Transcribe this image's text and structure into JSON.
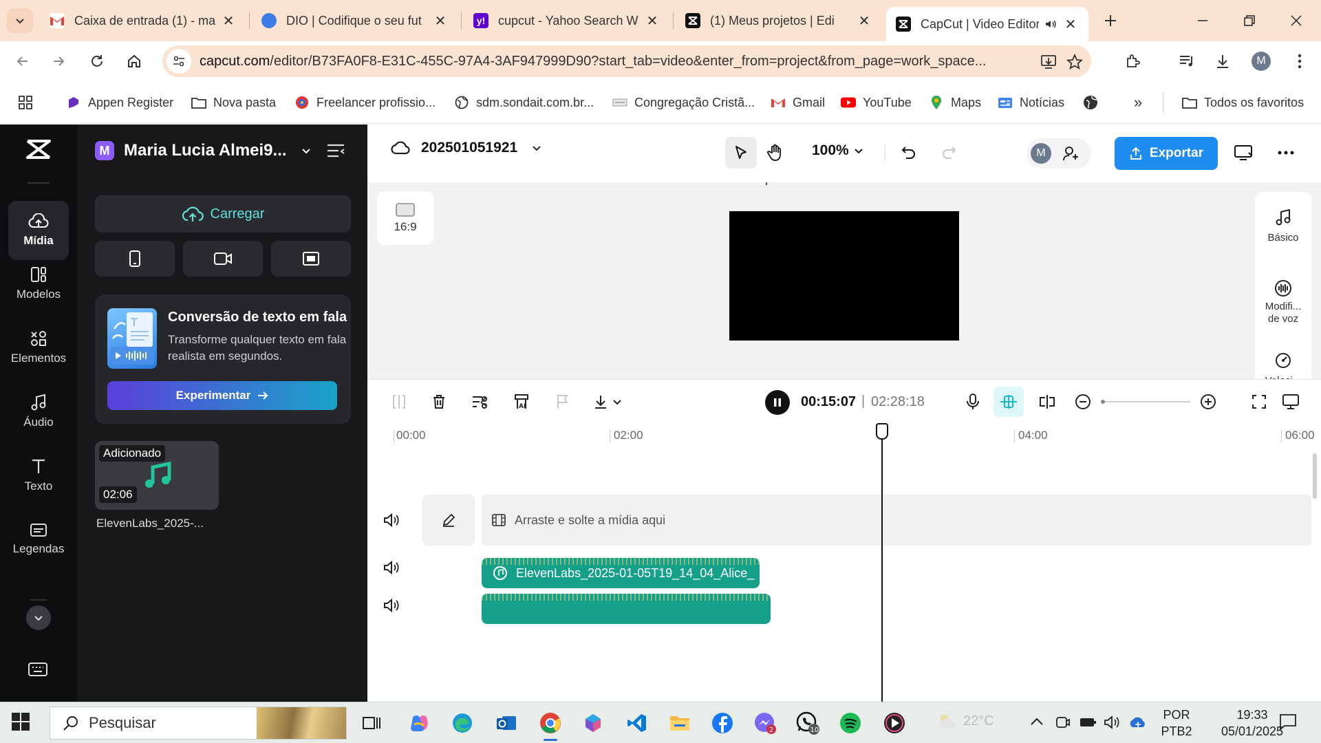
{
  "browser": {
    "tabs": [
      {
        "title": "Caixa de entrada (1) - ma",
        "favicon": "gmail-icon"
      },
      {
        "title": "DIO | Codifique o seu fut",
        "favicon": "dio-icon"
      },
      {
        "title": "cupcut - Yahoo Search W",
        "favicon": "yahoo-icon"
      },
      {
        "title": "(1)  Meus projetos | Edi",
        "favicon": "capcut-icon"
      },
      {
        "title": "CapCut | Video Editor",
        "favicon": "capcut-icon",
        "active": true
      }
    ],
    "url_host": "capcut.com",
    "url_rest": "/editor/B73FA0F8-E31C-455C-97A4-3AF947999D90?start_tab=video&enter_from=project&from_page=work_space...",
    "bookmarks": [
      "Appen Register",
      "Nova pasta",
      "Freelancer profissio...",
      "sdm.sondait.com.br...",
      "Congregação Cristã...",
      "Gmail",
      "YouTube",
      "Maps",
      "Notícias"
    ],
    "more_bookmarks": "»",
    "all_favorites": "Todos os favoritos",
    "profile_initial": "M"
  },
  "sidebar": {
    "items": [
      {
        "label": "Mídia",
        "icon": "cloud-upload-icon",
        "active": true
      },
      {
        "label": "Modelos",
        "icon": "templates-icon"
      },
      {
        "label": "Elementos",
        "icon": "elements-icon"
      },
      {
        "label": "Áudio",
        "icon": "music-note-icon"
      },
      {
        "label": "Texto",
        "icon": "text-icon"
      },
      {
        "label": "Legendas",
        "icon": "captions-icon"
      }
    ]
  },
  "panel": {
    "workspace_initial": "M",
    "workspace_name": "Maria Lucia Almei9...",
    "upload_label": "Carregar",
    "promo": {
      "title": "Conversão de texto em fala",
      "description": "Transforme qualquer texto em fala realista em segundos.",
      "button": "Experimentar"
    },
    "media_item": {
      "badge": "Adicionado",
      "duration": "02:06",
      "name": "ElevenLabs_2025-..."
    }
  },
  "editor": {
    "project_name": "202501051921",
    "zoom": "100%",
    "collaborator_initial": "M",
    "export_label": "Exportar",
    "aspect_ratio": "16:9",
    "side_props": [
      {
        "label": "Básico",
        "icon": "music-note-icon"
      },
      {
        "label": "Modifi... de voz",
        "icon": "voice-changer-icon"
      },
      {
        "label": "Veloci...",
        "icon": "speed-icon"
      }
    ]
  },
  "timeline": {
    "current_time": "00:15:07",
    "separator": "|",
    "total_time": "02:28:18",
    "ruler": [
      "00:00",
      "02:00",
      "04:00",
      "06:00"
    ],
    "main_track_placeholder": "Arraste e solte a mídia aqui",
    "audio_clip_label": "ElevenLabs_2025-01-05T19_14_04_Alice_"
  },
  "taskbar": {
    "search_placeholder": "Pesquisar",
    "temperature": "22°C",
    "lang_line1": "POR",
    "lang_line2": "PTB2",
    "time": "19:33",
    "date": "05/01/2025",
    "teams_badge": "2",
    "whatsapp_badge": "10"
  },
  "colors": {
    "accent": "#1e8cf0",
    "upload_text": "#5ee0d8",
    "audio_clip": "#15a08a",
    "sidebar_bg": "#0e0e10",
    "panel_bg": "#18181b"
  }
}
